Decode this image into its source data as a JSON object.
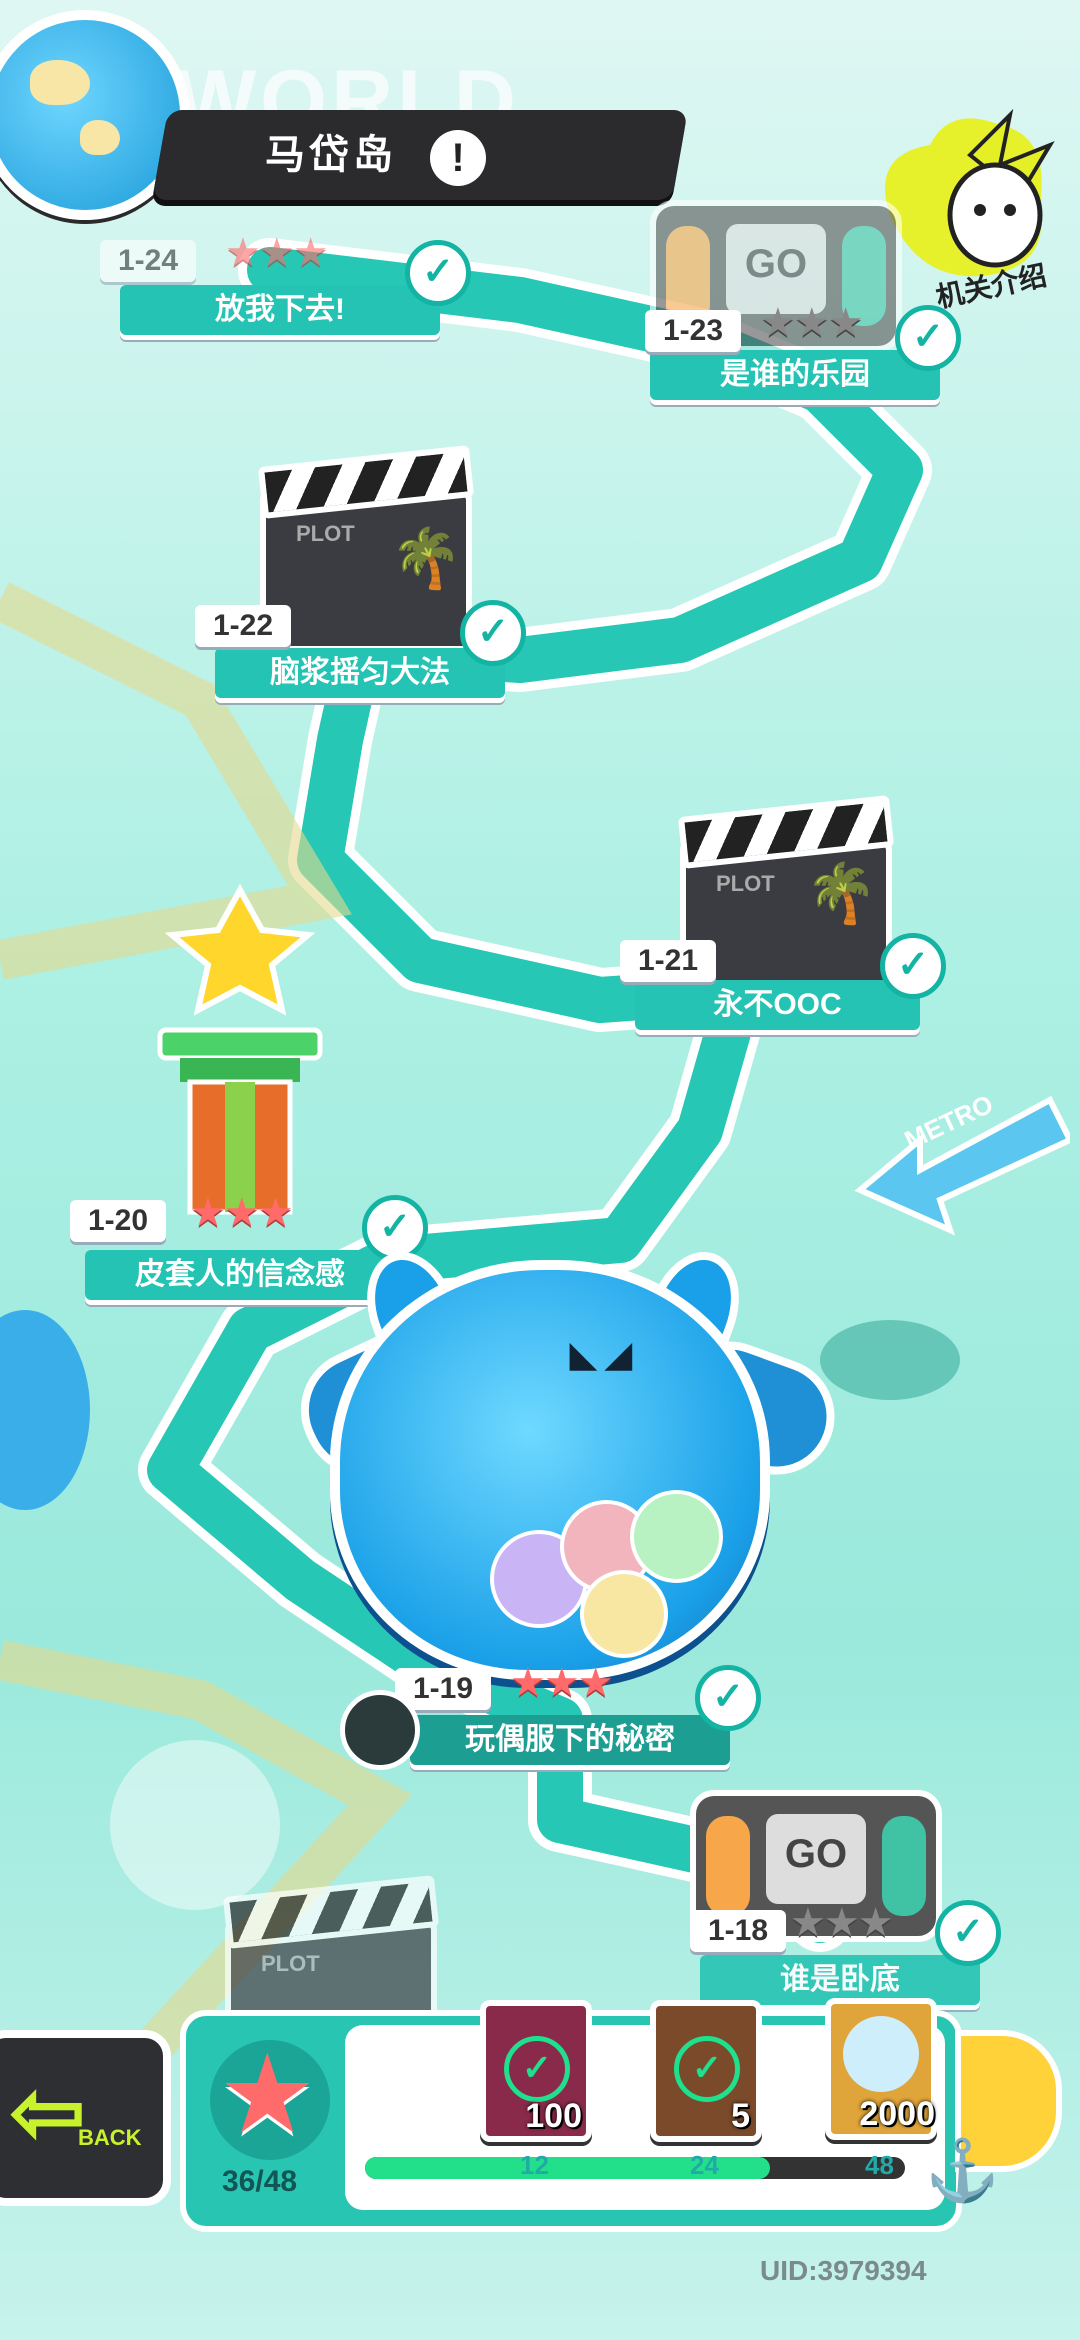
{
  "header": {
    "world_word": "WORLD",
    "island_name": "马岱岛",
    "alert_icon": "!",
    "intro_label": "机关介绍"
  },
  "levels": [
    {
      "id": "1-24",
      "name": "放我下去!",
      "stars": 3,
      "cleared": true
    },
    {
      "id": "1-23",
      "name": "是谁的乐园",
      "stars": 3,
      "cleared": true
    },
    {
      "id": "1-22",
      "name": "脑浆摇匀大法",
      "cleared": true
    },
    {
      "id": "1-21",
      "name": "永不OOC",
      "cleared": true
    },
    {
      "id": "1-20",
      "name": "皮套人的信念感",
      "stars": 3,
      "cleared": true
    },
    {
      "id": "1-19",
      "name": "玩偶服下的秘密",
      "stars": 3,
      "cleared": true
    },
    {
      "id": "1-18",
      "name": "谁是卧底",
      "stars": 3,
      "cleared": true
    }
  ],
  "clapper_text": "PLOT",
  "console_text": "GO",
  "decorations": {
    "metro_sign": "METRO"
  },
  "bottom": {
    "back_label": "BACK",
    "star_progress": "36/48",
    "rewards": [
      {
        "qty": "100",
        "claimed": true,
        "color": "#8a2a4a"
      },
      {
        "qty": "5",
        "claimed": true,
        "color": "#7a4a2a"
      },
      {
        "qty": "2000",
        "claimed": false,
        "color": "#e0a53a"
      }
    ],
    "milestones": [
      "12",
      "24",
      "48"
    ],
    "progress_fraction": 0.75
  },
  "uid": "UID:3979394"
}
